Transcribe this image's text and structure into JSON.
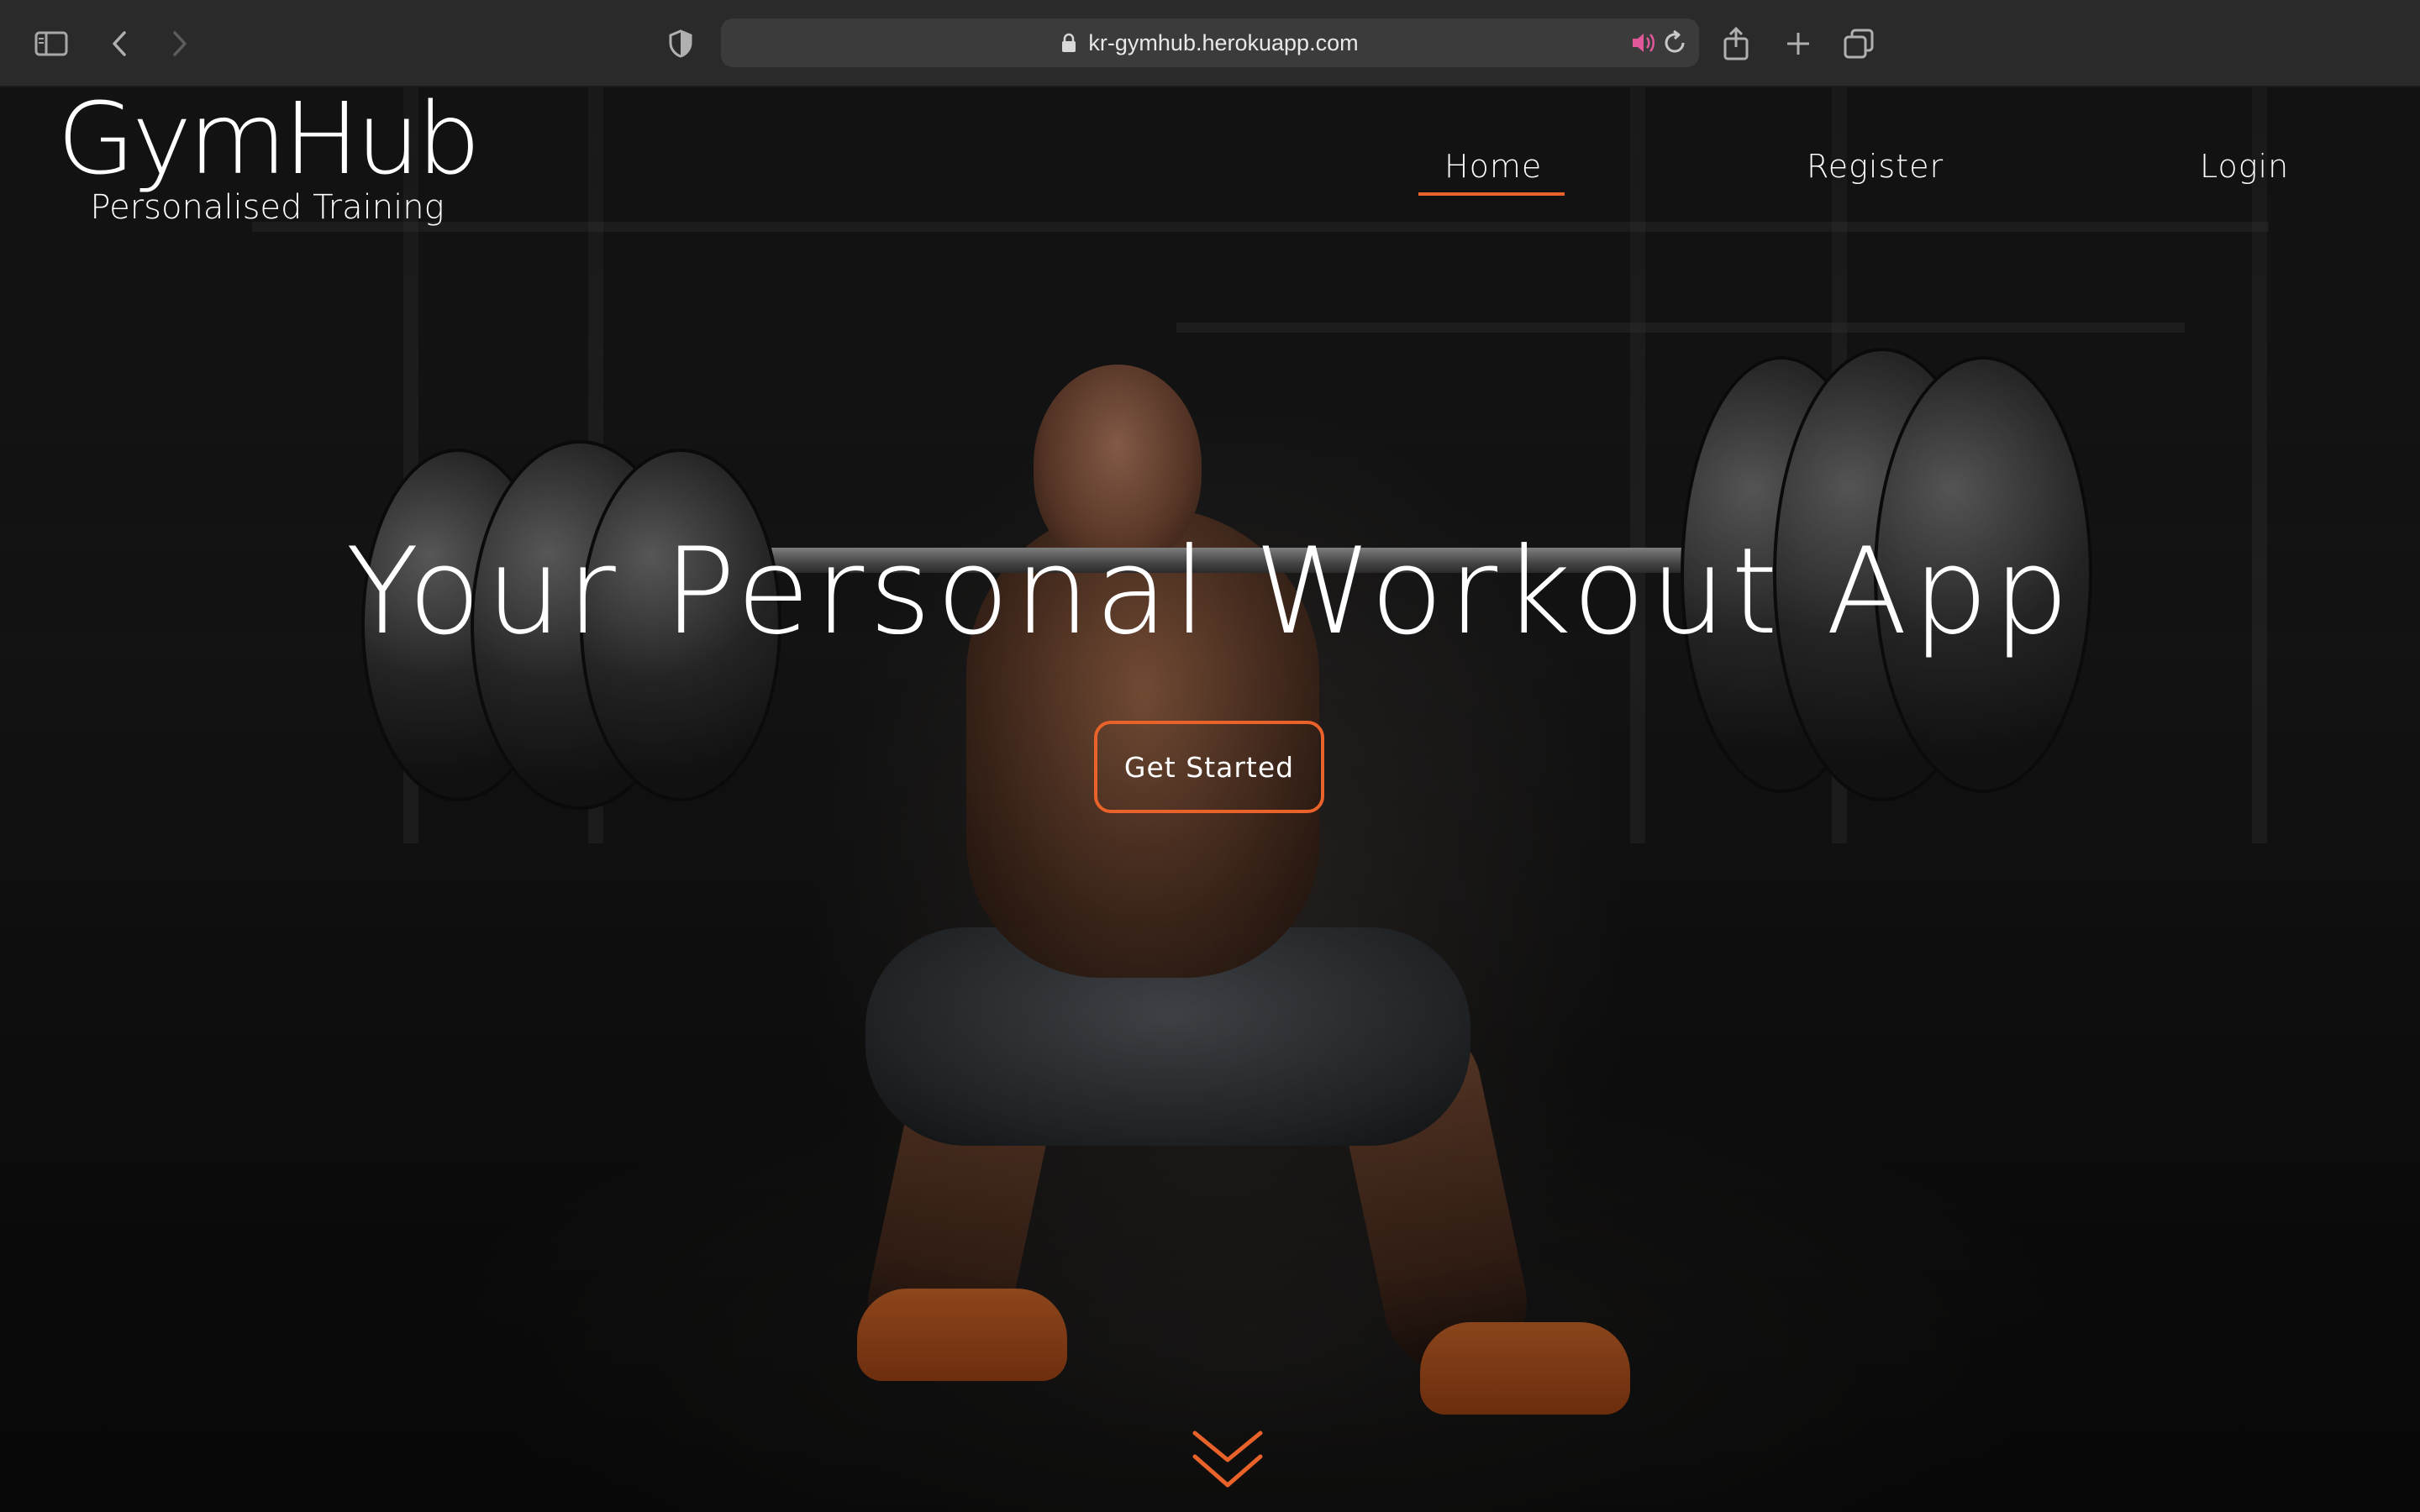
{
  "browser": {
    "url": "kr-gymhub.herokuapp.com",
    "icons": [
      "sidebar-icon",
      "back-icon",
      "forward-icon",
      "shield-icon",
      "lock-icon",
      "speaker-icon",
      "reload-icon",
      "share-icon",
      "new-tab-icon",
      "tabs-overview-icon"
    ]
  },
  "site": {
    "logo": {
      "title": "GymHub",
      "subtitle": "Personalised Training"
    },
    "nav": [
      {
        "label": "Home",
        "active": true
      },
      {
        "label": "Register",
        "active": false
      },
      {
        "label": "Login",
        "active": false
      }
    ],
    "hero": {
      "headline": "Your Personal Workout App",
      "cta_label": "Get Started"
    }
  },
  "colors": {
    "accent": "#e8622a",
    "speaker_icon": "#e0589a",
    "text": "#ffffff"
  }
}
